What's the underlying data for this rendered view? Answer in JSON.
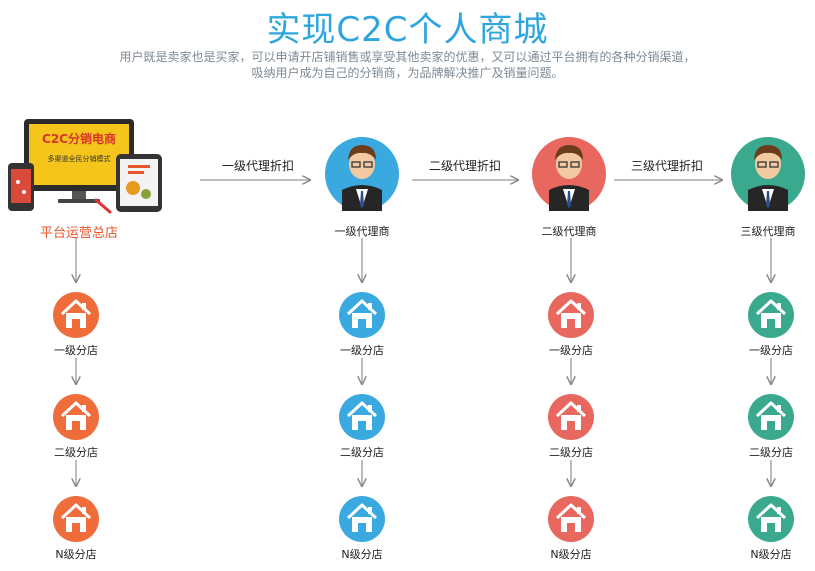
{
  "title": "实现C2C个人商城",
  "subtitle_line1": "用户既是卖家也是买家，可以申请开店铺销售或享受其他卖家的优惠，又可以通过平台拥有的各种分销渠道，",
  "subtitle_line2": "吸纳用户成为自己的分销商，为品牌解决推广及销量问题。",
  "platform": {
    "label": "平台运营总店",
    "screen_title": "C2C分销电商",
    "screen_sub": "多渠道全民分销模式"
  },
  "transitions": [
    "一级代理折扣",
    "二级代理折扣",
    "三级代理折扣"
  ],
  "agents": [
    {
      "label": "一级代理商",
      "color": "#3aa9e0"
    },
    {
      "label": "二级代理商",
      "color": "#e8685f"
    },
    {
      "label": "三级代理商",
      "color": "#3aa98d"
    }
  ],
  "columns": [
    {
      "color": "#ee6d3a",
      "shops": [
        "一级分店",
        "二级分店",
        "N级分店"
      ]
    },
    {
      "color": "#3aa9e0",
      "shops": [
        "一级分店",
        "二级分店",
        "N级分店"
      ]
    },
    {
      "color": "#e8685f",
      "shops": [
        "一级分店",
        "二级分店",
        "N级分店"
      ]
    },
    {
      "color": "#3aa98d",
      "shops": [
        "一级分店",
        "二级分店",
        "N级分店"
      ]
    }
  ]
}
